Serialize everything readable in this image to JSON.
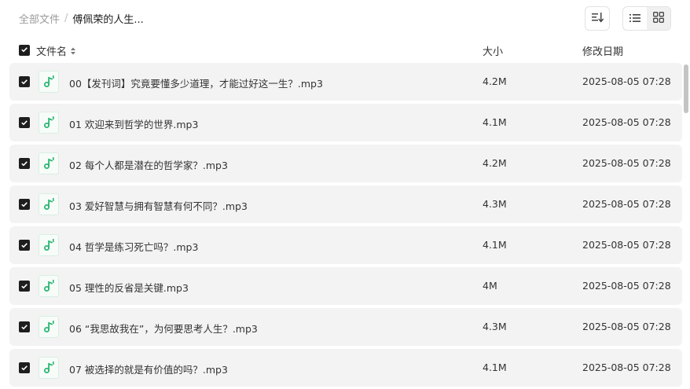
{
  "breadcrumb": {
    "root": "全部文件",
    "separator": "/",
    "current": "傅佩荣的人生..."
  },
  "toolbar": {
    "sort_icon": "sort-lines-icon",
    "view_list_icon": "list-view-icon",
    "view_grid_icon": "grid-view-icon",
    "active_view": "list"
  },
  "columns": {
    "name": "文件名",
    "size": "大小",
    "modified": "修改日期"
  },
  "files": [
    {
      "name": "00【发刊词】究竟要懂多少道理，才能过好这一生？.mp3",
      "size": "4.2M",
      "modified": "2025-08-05 07:28",
      "checked": true
    },
    {
      "name": "01 欢迎来到哲学的世界.mp3",
      "size": "4.1M",
      "modified": "2025-08-05 07:28",
      "checked": true
    },
    {
      "name": "02 每个人都是潜在的哲学家？.mp3",
      "size": "4.2M",
      "modified": "2025-08-05 07:28",
      "checked": true
    },
    {
      "name": "03 爱好智慧与拥有智慧有何不同？.mp3",
      "size": "4.3M",
      "modified": "2025-08-05 07:28",
      "checked": true
    },
    {
      "name": "04 哲学是练习死亡吗？.mp3",
      "size": "4.1M",
      "modified": "2025-08-05 07:28",
      "checked": true
    },
    {
      "name": "05 理性的反省是关键.mp3",
      "size": "4M",
      "modified": "2025-08-05 07:28",
      "checked": true
    },
    {
      "name": "06 “我思故我在”，为何要思考人生？.mp3",
      "size": "4.3M",
      "modified": "2025-08-05 07:28",
      "checked": true
    },
    {
      "name": "07 被选择的就是有价值的吗？.mp3",
      "size": "4.1M",
      "modified": "2025-08-05 07:28",
      "checked": true
    }
  ],
  "colors": {
    "accent_green": "#2bb673",
    "checkbox": "#1e1e1e",
    "row_bg": "#f3f3f3"
  }
}
